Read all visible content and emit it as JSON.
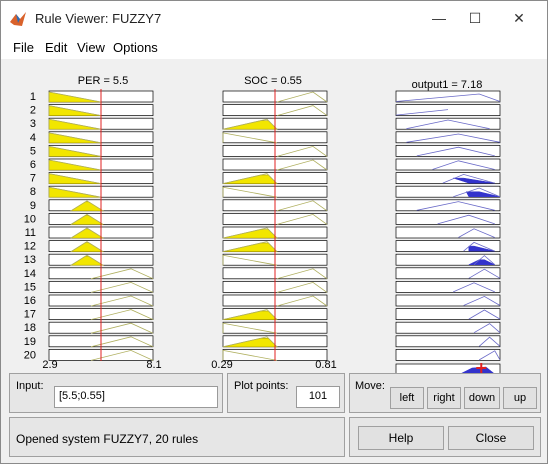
{
  "window": {
    "title": "Rule Viewer: FUZZY7",
    "minimize": "—",
    "maximize": "☐",
    "close": "✕"
  },
  "menu": {
    "items": [
      "File",
      "Edit",
      "View",
      "Options"
    ]
  },
  "colors": {
    "mf_fill": "#f2e600",
    "mf_line": "#b0b060",
    "out_line": "#6a6ac8",
    "out_fill": "#3333cc",
    "cursor": "#e02020"
  },
  "inputs": [
    {
      "label": "PER = 5.5",
      "range": [
        "2.9",
        "8.1"
      ],
      "min": 2.9,
      "max": 8.1,
      "value": 5.5,
      "mfs": {
        "low": [
          2.9,
          2.9,
          5.5
        ],
        "mid": [
          4.0,
          4.8,
          5.6
        ],
        "high": [
          5.0,
          7.0,
          8.1
        ]
      }
    },
    {
      "label": "SOC = 0.55",
      "range": [
        "0.29",
        "0.81"
      ],
      "min": 0.29,
      "max": 0.81,
      "value": 0.55,
      "mfs": {
        "low": [
          0.29,
          0.29,
          0.56
        ],
        "mid": [
          0.29,
          0.51,
          0.56
        ],
        "high": [
          0.56,
          0.74,
          0.81
        ]
      }
    }
  ],
  "output": {
    "label": "output1 = 7.18",
    "value": 7.18
  },
  "rules": {
    "numbers": [
      "1",
      "2",
      "3",
      "4",
      "5",
      "6",
      "7",
      "8",
      "9",
      "10",
      "11",
      "12",
      "13",
      "14",
      "15",
      "16",
      "17",
      "18",
      "19",
      "20"
    ],
    "per": [
      "low",
      "low",
      "low",
      "low",
      "low",
      "low",
      "low",
      "low",
      "mid",
      "mid",
      "mid",
      "mid",
      "mid",
      "high",
      "high",
      "high",
      "high",
      "high",
      "high",
      "high"
    ],
    "soc": [
      "high",
      "high",
      "mid",
      "low",
      "high",
      "high",
      "mid",
      "low",
      "high",
      "high",
      "mid",
      "mid",
      "low",
      "high",
      "high",
      "high",
      "mid",
      "low",
      "mid",
      "low"
    ],
    "out_shape": [
      [
        0,
        0.8,
        1,
        0.5
      ],
      [
        0,
        0.5,
        0,
        1
      ],
      [
        0.1,
        0.5,
        0.9,
        0.2
      ],
      [
        0.1,
        0.6,
        1,
        0.3
      ],
      [
        0.2,
        0.6,
        0.95,
        0.2
      ],
      [
        0.35,
        0.6,
        0.95,
        0.2
      ],
      [
        0.45,
        0.65,
        0.95,
        0.2
      ],
      [
        0.55,
        0.8,
        1,
        0.2
      ],
      [
        0.2,
        0.6,
        0.95,
        0.2
      ],
      [
        0.4,
        0.7,
        0.95,
        0.2
      ],
      [
        0.6,
        0.75,
        0.95,
        0.2
      ],
      [
        0.65,
        0.75,
        0.95,
        0.2
      ],
      [
        0.75,
        0.85,
        0.95,
        0.1
      ],
      [
        0.7,
        0.85,
        1,
        0.1
      ],
      [
        0.55,
        0.75,
        0.95,
        0.1
      ],
      [
        0.65,
        0.85,
        1,
        0.1
      ],
      [
        0.7,
        0.85,
        1,
        0.1
      ],
      [
        0.75,
        0.9,
        1,
        0.1
      ],
      [
        0.8,
        0.9,
        1,
        0.1
      ],
      [
        0.8,
        0.95,
        1,
        0.1
      ]
    ],
    "out_fill_rules": [
      7,
      8,
      12,
      13
    ]
  },
  "controls": {
    "input_label": "Input:",
    "input_value": "[5.5;0.55]",
    "plot_points_label": "Plot points:",
    "plot_points_value": "101",
    "move_label": "Move:",
    "move_left": "left",
    "move_right": "right",
    "move_down": "down",
    "move_up": "up"
  },
  "status": "Opened system FUZZY7, 20 rules",
  "buttons": {
    "help": "Help",
    "close": "Close"
  }
}
